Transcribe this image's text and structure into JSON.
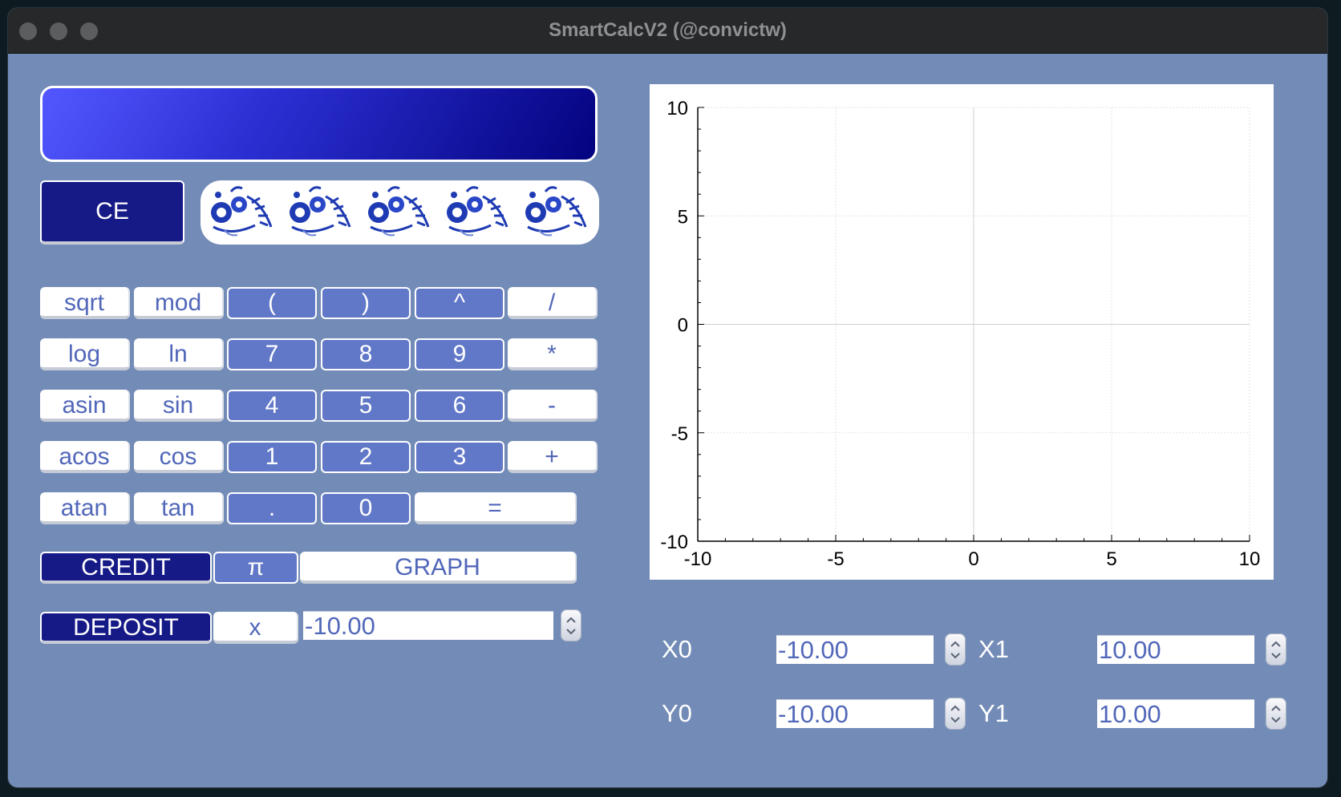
{
  "window": {
    "title": "SmartCalcV2 (@convictw)"
  },
  "display": {
    "value": ""
  },
  "buttons": {
    "ce": "CE",
    "grid": [
      {
        "key": "sqrt",
        "label": "sqrt",
        "style": "w"
      },
      {
        "key": "mod",
        "label": "mod",
        "style": "w"
      },
      {
        "key": "lparen",
        "label": "(",
        "style": "b"
      },
      {
        "key": "rparen",
        "label": ")",
        "style": "b"
      },
      {
        "key": "pow",
        "label": "^",
        "style": "b"
      },
      {
        "key": "div",
        "label": "/",
        "style": "w"
      },
      {
        "key": "log",
        "label": "log",
        "style": "w"
      },
      {
        "key": "ln",
        "label": "ln",
        "style": "w"
      },
      {
        "key": "7",
        "label": "7",
        "style": "b"
      },
      {
        "key": "8",
        "label": "8",
        "style": "b"
      },
      {
        "key": "9",
        "label": "9",
        "style": "b"
      },
      {
        "key": "mul",
        "label": "*",
        "style": "w"
      },
      {
        "key": "asin",
        "label": "asin",
        "style": "w"
      },
      {
        "key": "sin",
        "label": "sin",
        "style": "w"
      },
      {
        "key": "4",
        "label": "4",
        "style": "b"
      },
      {
        "key": "5",
        "label": "5",
        "style": "b"
      },
      {
        "key": "6",
        "label": "6",
        "style": "b"
      },
      {
        "key": "minus",
        "label": "-",
        "style": "w"
      },
      {
        "key": "acos",
        "label": "acos",
        "style": "w"
      },
      {
        "key": "cos",
        "label": "cos",
        "style": "w"
      },
      {
        "key": "1",
        "label": "1",
        "style": "b"
      },
      {
        "key": "2",
        "label": "2",
        "style": "b"
      },
      {
        "key": "3",
        "label": "3",
        "style": "b"
      },
      {
        "key": "plus",
        "label": "+",
        "style": "w"
      },
      {
        "key": "atan",
        "label": "atan",
        "style": "w"
      },
      {
        "key": "tan",
        "label": "tan",
        "style": "w"
      },
      {
        "key": "dot",
        "label": ".",
        "style": "b"
      },
      {
        "key": "0",
        "label": "0",
        "style": "b"
      },
      {
        "key": "equals",
        "label": "=",
        "style": "w"
      }
    ],
    "credit": "CREDIT",
    "pi": "π",
    "graph": "GRAPH",
    "deposit": "DEPOSIT",
    "x": "x"
  },
  "x_value": "-10.00",
  "range": {
    "x0_label": "X0",
    "x0": "-10.00",
    "x1_label": "X1",
    "x1": "10.00",
    "y0_label": "Y0",
    "y0": "-10.00",
    "y1_label": "Y1",
    "y1": "10.00"
  },
  "chart_data": {
    "type": "line",
    "series": [],
    "xlim": [
      -10,
      10
    ],
    "ylim": [
      -10,
      10
    ],
    "xticks": [
      "-10",
      "-5",
      "0",
      "5",
      "10"
    ],
    "yticks": [
      "10",
      "5",
      "0",
      "-5",
      "-10"
    ],
    "grid": true
  }
}
